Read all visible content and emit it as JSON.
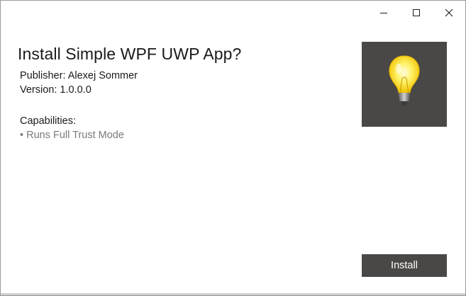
{
  "window": {
    "controls": {
      "minimize_icon": "minimize-icon",
      "maximize_icon": "maximize-icon",
      "close_icon": "close-icon"
    }
  },
  "installer": {
    "title": "Install Simple WPF UWP App?",
    "publisher": "Publisher: Alexej Sommer",
    "version": "Version: 1.0.0.0",
    "capabilities_heading": "Capabilities:",
    "capabilities": [
      "• Runs Full Trust Mode"
    ],
    "logo_icon": "lightbulb-icon",
    "logo_background": "#4a4846",
    "install_label": "Install",
    "install_button_color": "#4a4846"
  }
}
